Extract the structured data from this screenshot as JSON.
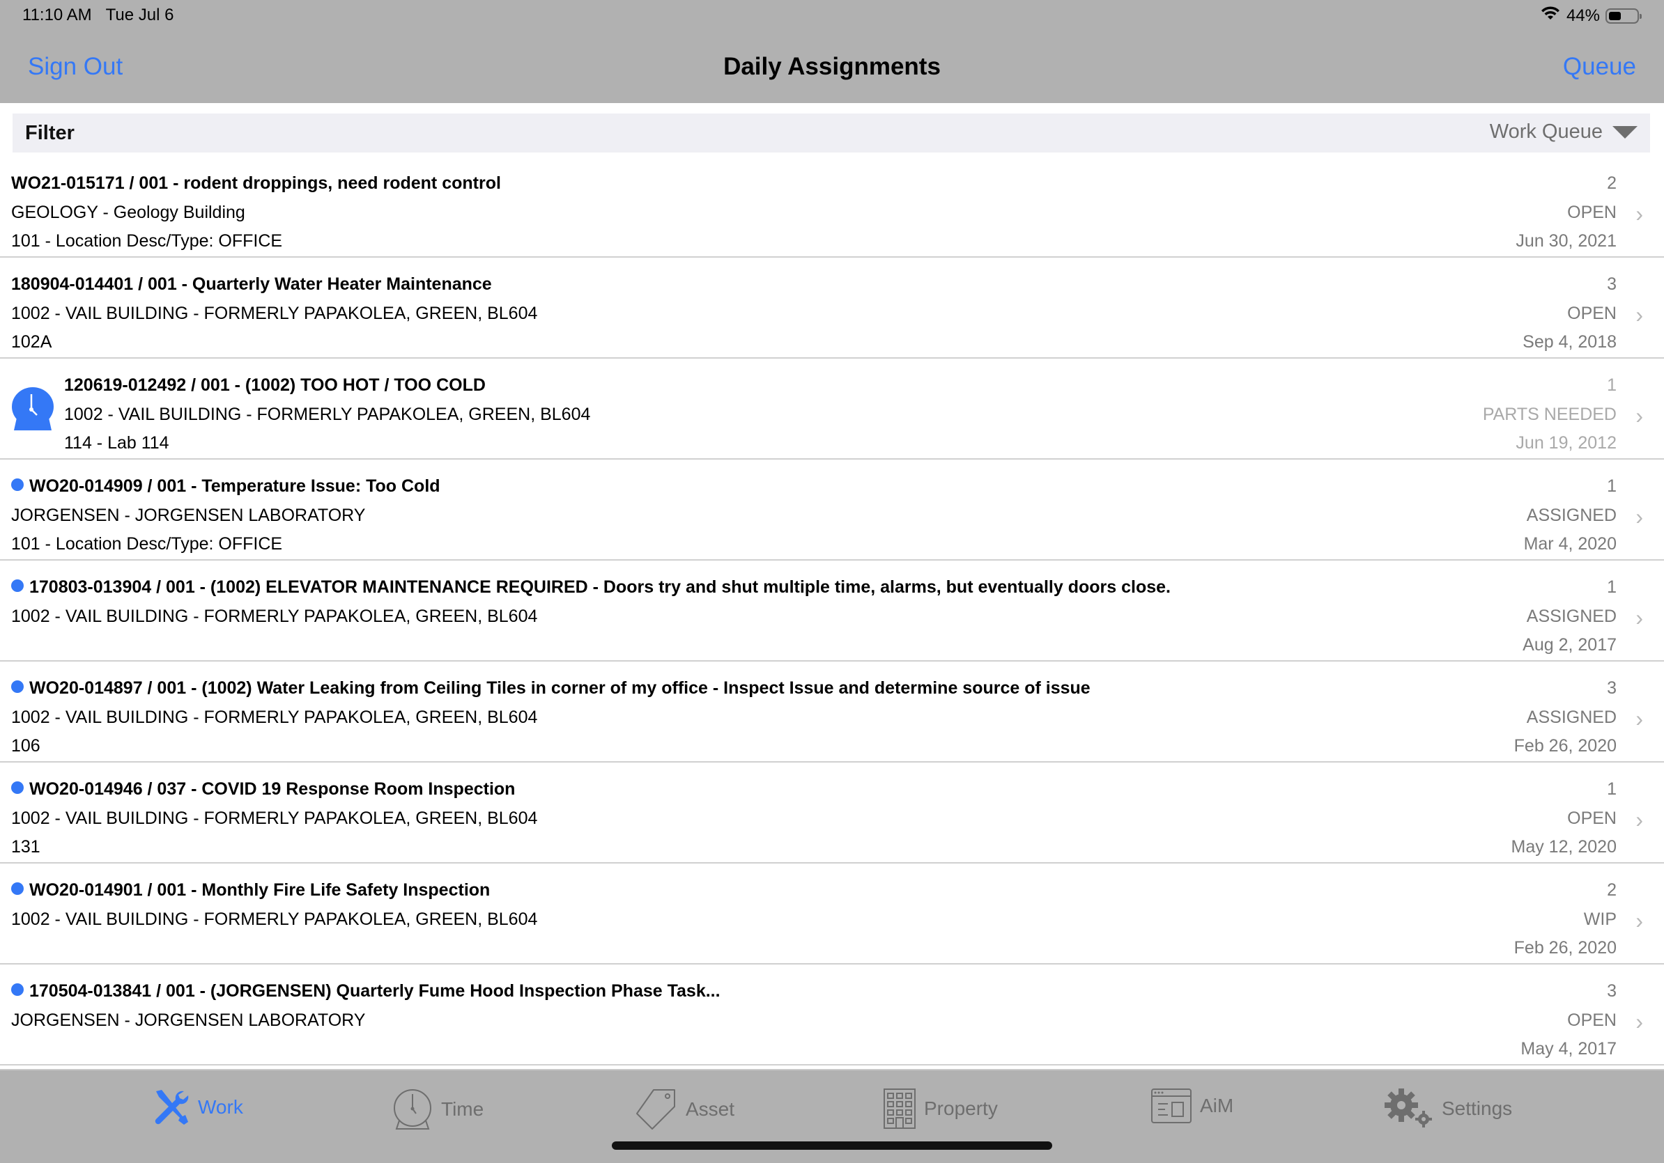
{
  "status_bar": {
    "time": "11:10 AM",
    "date": "Tue Jul 6",
    "wifi_icon": "wifi-icon",
    "battery_percent": "44%",
    "battery_level": 0.44
  },
  "nav": {
    "left_button": "Sign Out",
    "title": "Daily Assignments",
    "right_button": "Queue"
  },
  "filter": {
    "label": "Filter",
    "selected": "Work Queue"
  },
  "colors": {
    "accent": "#3478f6",
    "bar_bg": "#b1b1b1",
    "filter_bg": "#efeff4",
    "secondary_text": "#7a7a7a"
  },
  "work_orders": [
    {
      "title": "WO21-015171 / 001 - rodent droppings, need rodent control",
      "line2": "GEOLOGY - Geology Building",
      "line3": "101 - Location Desc/Type: OFFICE",
      "count": "2",
      "status": "OPEN",
      "date": "Jun 30, 2021",
      "unread_dot": false,
      "clock_icon": false
    },
    {
      "title": "180904-014401 / 001 - Quarterly Water Heater Maintenance",
      "line2": "1002 - VAIL BUILDING - FORMERLY PAPAKOLEA, GREEN, BL604",
      "line3": "102A",
      "count": "3",
      "status": "OPEN",
      "date": "Sep 4, 2018",
      "unread_dot": false,
      "clock_icon": false
    },
    {
      "title": "120619-012492 / 001 - (1002) TOO HOT / TOO COLD",
      "line2": "1002 - VAIL BUILDING - FORMERLY PAPAKOLEA, GREEN, BL604",
      "line3": "114 - Lab 114",
      "count": "1",
      "status": "PARTS NEEDED",
      "date": "Jun 19, 2012",
      "unread_dot": false,
      "clock_icon": true
    },
    {
      "title": "WO20-014909 / 001 - Temperature Issue: Too Cold",
      "line2": "JORGENSEN - JORGENSEN LABORATORY",
      "line3": "101 - Location Desc/Type: OFFICE",
      "count": "1",
      "status": "ASSIGNED",
      "date": "Mar 4, 2020",
      "unread_dot": true,
      "clock_icon": false
    },
    {
      "title": "170803-013904 / 001 - (1002) ELEVATOR MAINTENANCE REQUIRED - Doors try and shut multiple time, alarms, but eventually doors close.",
      "line2": "1002 - VAIL BUILDING - FORMERLY PAPAKOLEA, GREEN, BL604",
      "line3": "",
      "count": "1",
      "status": "ASSIGNED",
      "date": "Aug 2, 2017",
      "unread_dot": true,
      "clock_icon": false
    },
    {
      "title": "WO20-014897 / 001 - (1002) Water Leaking from Ceiling Tiles in corner of my office - Inspect Issue and determine source of issue",
      "line2": "1002 - VAIL BUILDING - FORMERLY PAPAKOLEA, GREEN, BL604",
      "line3": "106",
      "count": "3",
      "status": "ASSIGNED",
      "date": "Feb 26, 2020",
      "unread_dot": true,
      "clock_icon": false
    },
    {
      "title": "WO20-014946 / 037 - COVID 19 Response Room Inspection",
      "line2": "1002 - VAIL BUILDING - FORMERLY PAPAKOLEA, GREEN, BL604",
      "line3": "131",
      "count": "1",
      "status": "OPEN",
      "date": "May 12, 2020",
      "unread_dot": true,
      "clock_icon": false
    },
    {
      "title": "WO20-014901 / 001 - Monthly Fire Life Safety Inspection",
      "line2": "1002 - VAIL BUILDING - FORMERLY PAPAKOLEA, GREEN, BL604",
      "line3": "",
      "count": "2",
      "status": "WIP",
      "date": "Feb 26, 2020",
      "unread_dot": true,
      "clock_icon": false
    },
    {
      "title": "170504-013841 / 001 - (JORGENSEN) Quarterly Fume Hood Inspection Phase Task...",
      "line2": "JORGENSEN - JORGENSEN LABORATORY",
      "line3": "",
      "count": "3",
      "status": "OPEN",
      "date": "May 4, 2017",
      "unread_dot": true,
      "clock_icon": false
    }
  ],
  "tabs": [
    {
      "label": "Work",
      "icon": "wrench-screwdriver-icon",
      "active": true
    },
    {
      "label": "Time",
      "icon": "clock-icon",
      "active": false
    },
    {
      "label": "Asset",
      "icon": "tag-icon",
      "active": false
    },
    {
      "label": "Property",
      "icon": "building-icon",
      "active": false
    },
    {
      "label": "AiM",
      "icon": "browser-window-icon",
      "active": false
    },
    {
      "label": "Settings",
      "icon": "gears-icon",
      "active": false
    }
  ]
}
